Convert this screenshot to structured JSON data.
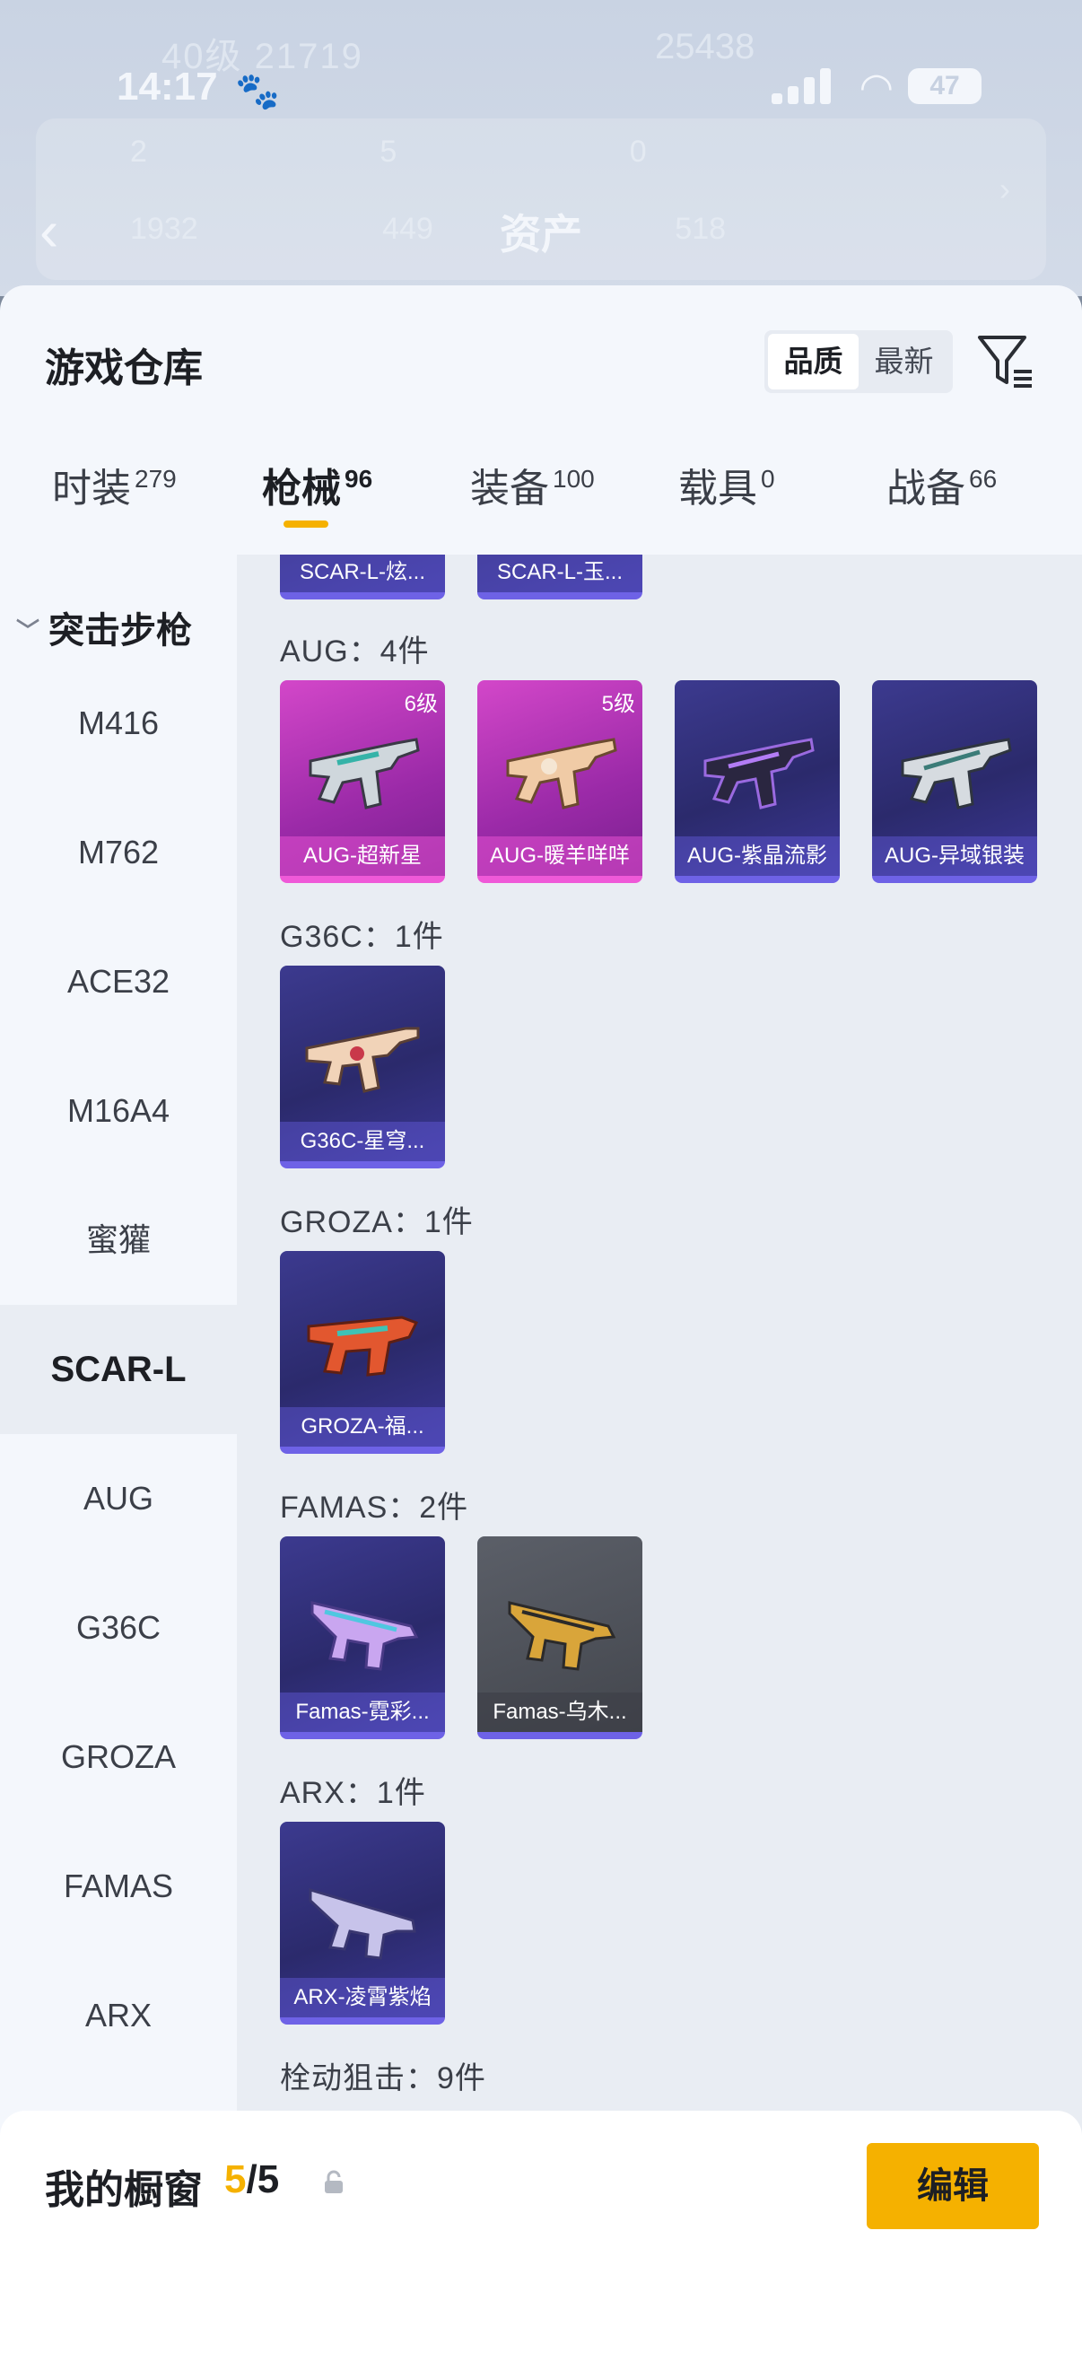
{
  "background": {
    "status_bar": {
      "time": "14:17",
      "battery": "47"
    },
    "faded_texts": [
      "40级",
      "21719",
      "25438"
    ],
    "stats_row1": [
      "2",
      "5",
      "0"
    ],
    "stats_row2": [
      "1932",
      "449",
      "518"
    ],
    "page_title": "资产"
  },
  "sheet": {
    "title": "游戏仓库",
    "sort_options": [
      "品质",
      "最新"
    ],
    "active_sort": "品质"
  },
  "tabs": [
    {
      "label": "时装",
      "count": "279"
    },
    {
      "label": "枪械",
      "count": "96"
    },
    {
      "label": "装备",
      "count": "100"
    },
    {
      "label": "载具",
      "count": "0"
    },
    {
      "label": "战备",
      "count": "66"
    }
  ],
  "categories": {
    "group": "突击步枪",
    "items": [
      "M416",
      "M762",
      "ACE32",
      "M16A4",
      "蜜獾",
      "SCAR-L",
      "AUG",
      "G36C",
      "GROZA",
      "FAMAS",
      "ARX"
    ],
    "active": "SCAR-L"
  },
  "content": {
    "partial_items": [
      "SCAR-L-炫...",
      "SCAR-L-玉..."
    ],
    "sections": [
      {
        "title": "AUG：4件",
        "items": [
          {
            "name": "AUG-超新星",
            "level": "6级"
          },
          {
            "name": "AUG-暖羊咩咩",
            "level": "5级"
          },
          {
            "name": "AUG-紫晶流影",
            "level": ""
          },
          {
            "name": "AUG-异域银装",
            "level": ""
          }
        ]
      },
      {
        "title": "G36C：1件",
        "items": [
          {
            "name": "G36C-星穹...",
            "level": ""
          }
        ]
      },
      {
        "title": "GROZA：1件",
        "items": [
          {
            "name": "GROZA-福...",
            "level": ""
          }
        ]
      },
      {
        "title": "FAMAS：2件",
        "items": [
          {
            "name": "Famas-霓彩...",
            "level": ""
          },
          {
            "name": "Famas-乌木...",
            "level": ""
          }
        ]
      },
      {
        "title": "ARX：1件",
        "items": [
          {
            "name": "ARX-凌霄紫焰",
            "level": ""
          }
        ]
      },
      {
        "title": "栓动狙击：9件",
        "items": []
      }
    ]
  },
  "bottom": {
    "showcase_label": "我的橱窗",
    "count_current": "5",
    "count_total": "/5",
    "edit_label": "编辑"
  },
  "colors": {
    "accent": "#f5b100",
    "rare_blue": "#6e62e6",
    "rare_pink": "#ef59d8"
  }
}
